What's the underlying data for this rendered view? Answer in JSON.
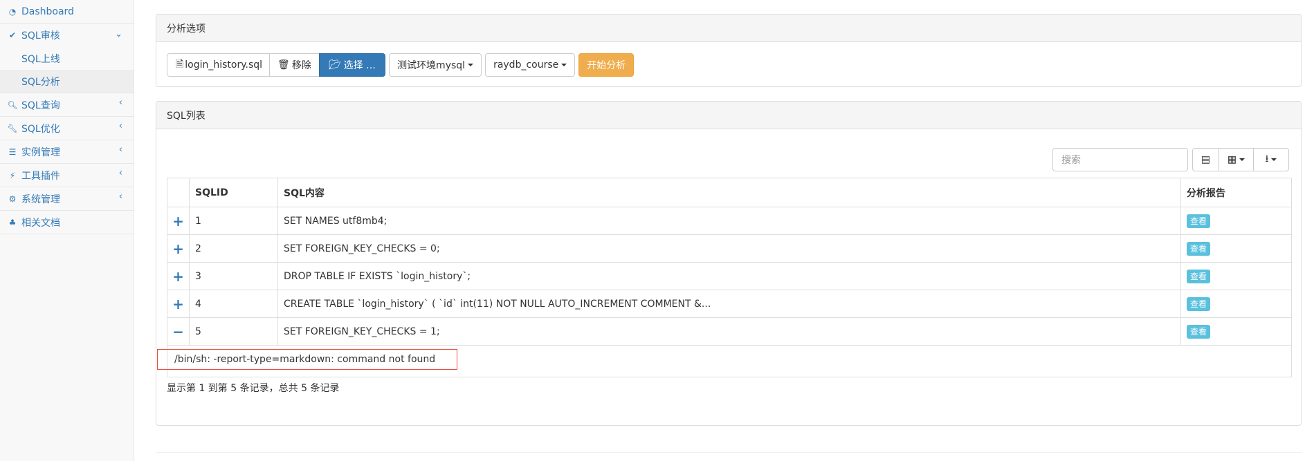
{
  "sidebar": {
    "items": [
      {
        "label": "Dashboard",
        "icon": "dashboard-icon"
      },
      {
        "label": "SQL审核",
        "icon": "check-icon",
        "expanded": true,
        "children": [
          {
            "label": "SQL上线"
          },
          {
            "label": "SQL分析",
            "active": true
          }
        ]
      },
      {
        "label": "SQL查询",
        "icon": "search-icon"
      },
      {
        "label": "SQL优化",
        "icon": "wrench-icon"
      },
      {
        "label": "实例管理",
        "icon": "database-icon"
      },
      {
        "label": "工具插件",
        "icon": "plug-icon"
      },
      {
        "label": "系统管理",
        "icon": "cogs-icon"
      },
      {
        "label": "相关文档",
        "icon": "sitemap-icon"
      }
    ]
  },
  "analysis_panel": {
    "title": "分析选项",
    "file_name": "login_history.sql",
    "remove_label": "移除",
    "choose_label": "选择 …",
    "instance_value": "测试环境mysql",
    "database_value": "raydb_course",
    "start_label": "开始分析"
  },
  "list_panel": {
    "title": "SQL列表",
    "search_placeholder": "搜索",
    "columns": {
      "id": "SQLID",
      "content": "SQL内容",
      "report": "分析报告"
    },
    "rows": [
      {
        "expand": "+",
        "id": "1",
        "content": "SET NAMES utf8mb4;",
        "action": "查看"
      },
      {
        "expand": "+",
        "id": "2",
        "content": "SET FOREIGN_KEY_CHECKS = 0;",
        "action": "查看"
      },
      {
        "expand": "+",
        "id": "3",
        "content": "DROP TABLE IF EXISTS `login_history`;",
        "action": "查看"
      },
      {
        "expand": "+",
        "id": "4",
        "content": "CREATE TABLE `login_history` ( `id` int(11) NOT NULL AUTO_INCREMENT COMMENT &...",
        "action": "查看"
      },
      {
        "expand": "−",
        "id": "5",
        "content": "SET FOREIGN_KEY_CHECKS = 1;",
        "action": "查看"
      }
    ],
    "detail_text": "/bin/sh: -report-type=markdown: command not found",
    "stats_text": "显示第 1 到第 5 条记录，总共 5 条记录"
  },
  "colors": {
    "link": "#337ab7",
    "primary": "#337ab7",
    "warning": "#f0ad4e",
    "info": "#5bc0de",
    "error_border": "#e74c3c"
  }
}
